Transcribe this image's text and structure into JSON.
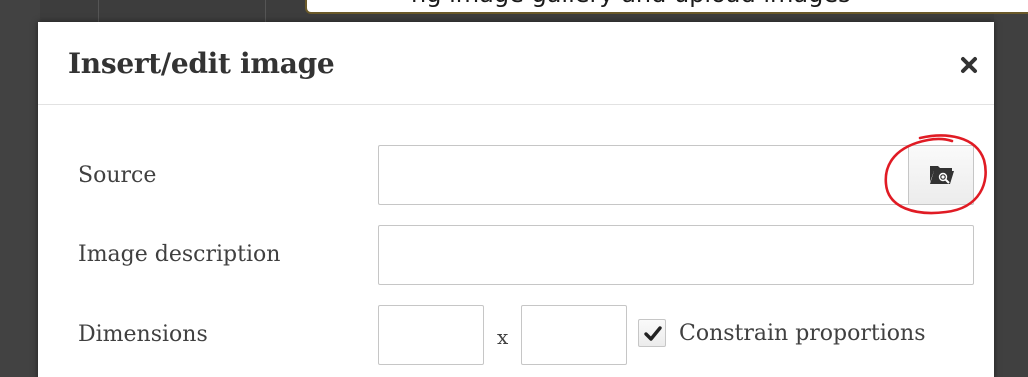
{
  "background": {
    "tab_text": "ng image gallery and upload images"
  },
  "dialog": {
    "title": "Insert/edit image",
    "close_glyph": "×",
    "fields": {
      "source": {
        "label": "Source",
        "value": "",
        "browse_icon": "folder-search-icon"
      },
      "description": {
        "label": "Image description",
        "value": ""
      },
      "dimensions": {
        "label": "Dimensions",
        "width_value": "",
        "separator": "x",
        "height_value": "",
        "constrain_label": "Constrain proportions",
        "constrain_checked": true
      }
    }
  },
  "annotation": {
    "shape": "hand-drawn-circle",
    "color": "#e01b24",
    "target": "browse-button"
  },
  "colors": {
    "dialog_bg": "#ffffff",
    "backdrop": "#3f3f3f",
    "label_text": "#404040",
    "title_text": "#333333",
    "input_border": "#c6c6c6"
  }
}
